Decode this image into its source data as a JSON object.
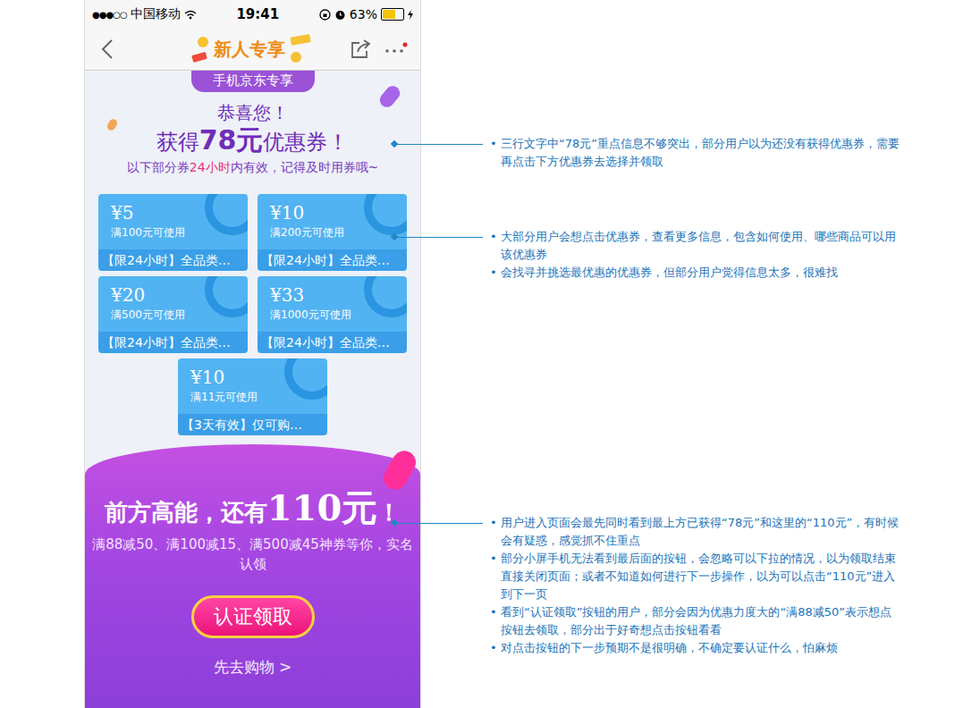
{
  "status_bar": {
    "signal": "●●●○○",
    "carrier": "中国移动",
    "time": "19:41",
    "battery": "63%",
    "battery_level": 0.63
  },
  "nav": {
    "title": "新人专享"
  },
  "page": {
    "tag": "手机京东专享",
    "greeting": "恭喜您！",
    "headline": {
      "before": "获得",
      "amount": "78元",
      "after": "优惠券！"
    },
    "notice": {
      "before": "以下部分券",
      "highlight": "24小时",
      "after": "内有效，记得及时用券哦~"
    }
  },
  "coupons": [
    {
      "amount": "¥5",
      "condition": "满100元可使用",
      "note": "【限24小时】全品类…"
    },
    {
      "amount": "¥10",
      "condition": "满200元可使用",
      "note": "【限24小时】全品类…"
    },
    {
      "amount": "¥20",
      "condition": "满500元可使用",
      "note": "【限24小时】全品类…"
    },
    {
      "amount": "¥33",
      "condition": "满1000元可使用",
      "note": "【限24小时】全品类…"
    },
    {
      "amount": "¥10",
      "condition": "满11元可使用",
      "note": "【3天有效】仅可购…"
    }
  ],
  "bonus": {
    "headline_before": "前方高能，还有",
    "headline_amount": "110元",
    "headline_after": "！",
    "description": "满88减50、满100减15、满500减45神券等你，实名认领",
    "button": "认证领取",
    "secondary": "先去购物 >"
  },
  "annotations": [
    {
      "bullet": "•",
      "items": [
        "三行文字中“78元”重点信息不够突出，部分用户以为还没有获得优惠券，需要再点击下方优惠券去选择并领取"
      ]
    },
    {
      "bullet": "•",
      "items": [
        "大部分用户会想点击优惠券，查看更多信息，包含如何使用、哪些商品可以用该优惠券",
        "会找寻并挑选最优惠的优惠券，但部分用户觉得信息太多，很难找"
      ]
    },
    {
      "bullet": "•",
      "items": [
        "用户进入页面会最先同时看到最上方已获得“78元”和这里的“110元”，有时候会有疑惑，感觉抓不住重点",
        "部分小屏手机无法看到最后面的按钮，会忽略可以下拉的情况，以为领取结束直接关闭页面；或者不知道如何进行下一步操作，以为可以点击“110元”进入到下一页",
        "看到“认证领取”按钮的用户，部分会因为优惠力度大的“满88减50”表示想点按钮去领取，部分出于好奇想点击按钮看看",
        "对点击按钮的下一步预期不是很明确，不确定要认证什么，怕麻烦"
      ]
    }
  ]
}
